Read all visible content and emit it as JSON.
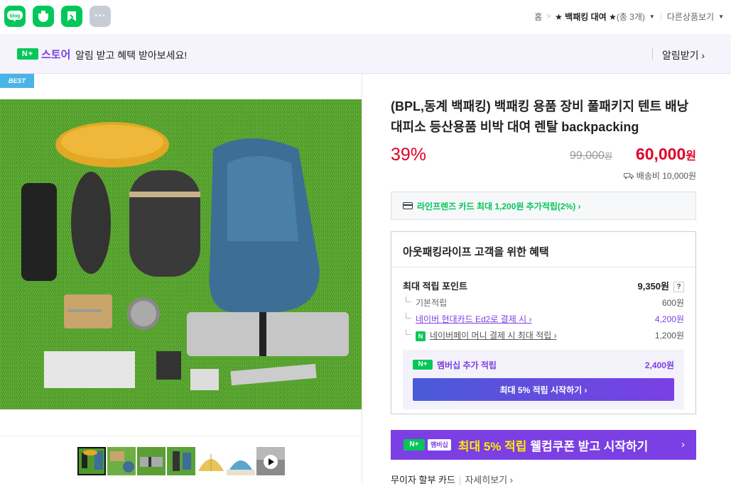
{
  "topbar": {
    "apps": [
      {
        "name": "blog",
        "label": "blog"
      },
      {
        "name": "cafe",
        "label": ""
      },
      {
        "name": "shortcut",
        "label": ""
      },
      {
        "name": "more",
        "label": "···"
      }
    ],
    "breadcrumb": {
      "home": "홈",
      "sep": ">",
      "current": "★ 백패킹 대여 ★",
      "count": "(총 3개)",
      "other": "다른상품보기"
    }
  },
  "notify": {
    "badge": "N+",
    "store": "스토어",
    "message": "알림 받고 혜택 받아보세요!",
    "subscribe": "알림받기 ›"
  },
  "gallery": {
    "badge": "BEST",
    "thumb_count": 7
  },
  "product": {
    "title": "(BPL,동계 백패킹) 백패킹 용품 장비 풀패키지 텐트 배낭 대피소 등산용품 비박 대여 렌탈 backpacking",
    "discount": "39%",
    "original_price": "99,000",
    "original_unit": "원",
    "price": "60,000",
    "price_unit": "원",
    "shipping": "배송비 10,000원"
  },
  "card_promo": "라인프렌즈 카드 최대 1,200원 추가적립(2%) ›",
  "benefit": {
    "title": "아웃패킹라이프 고객을 위한 혜택",
    "max_points_label": "최대 적립 포인트",
    "max_points_value": "9,350원",
    "help": "?",
    "rows": [
      {
        "label": "기본적립",
        "value": "600원"
      },
      {
        "label": "네이버 현대카드 Ed2로 결제 시 ›",
        "value": "4,200원"
      },
      {
        "label": "네이버페이 머니 결제 시 최대 적립 ›",
        "value": "1,200원"
      }
    ],
    "npay_badge": "N",
    "membership": {
      "badge": "N+",
      "label": "멤버십 추가 적립",
      "value": "2,400원",
      "button": "최대 5% 적립 시작하기 ›"
    }
  },
  "coupon_banner": {
    "badge": "N+",
    "membership": "멤버십",
    "highlight": "최대 5% 적립",
    "rest": "웰컴쿠폰 받고 시작하기",
    "arrow": "›"
  },
  "installment": {
    "label": "무이자 할부 카드",
    "more": "자세히보기 ›"
  },
  "colors": {
    "naver_green": "#03c75a",
    "purple": "#7b3fe4",
    "price_red": "#e0002a",
    "best_blue": "#4bb4e6"
  }
}
